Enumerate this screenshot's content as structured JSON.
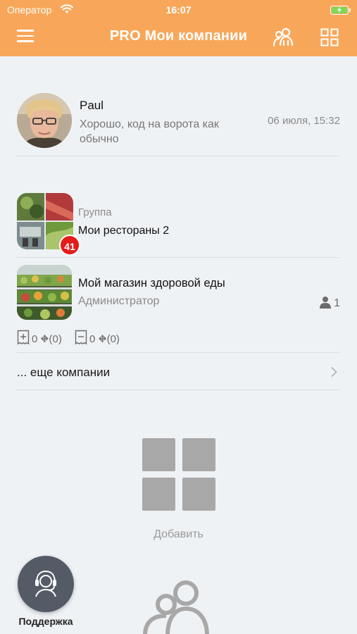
{
  "status_bar": {
    "carrier": "Оператор",
    "time": "16:07",
    "battery_color": "#7ed957"
  },
  "header": {
    "title": "PRO Мои компании",
    "background": "#f8a75a",
    "icons": [
      "menu-icon",
      "people-icon",
      "grid-icon"
    ]
  },
  "chat": {
    "name": "Paul",
    "message": "Хорошо, код на ворота как обычно",
    "time": "06 июля, 15:32"
  },
  "group": {
    "type": "Группа",
    "name": "Мои рестораны 2",
    "badge": "41",
    "badge_color": "#e41b1b"
  },
  "shop": {
    "name": "Мой магазин здоровой еды",
    "role": "Администратор",
    "user_count": "1"
  },
  "stats": {
    "plus_label": "0 ⛕(0)",
    "minus_label": "0 ⛕(0)",
    "plus_count": "0",
    "plus_paren": "(0)",
    "minus_count": "0",
    "minus_paren": "(0)"
  },
  "more": {
    "label": "... еще компании"
  },
  "add": {
    "label": "Добавить"
  },
  "support": {
    "label": "Поддержка"
  }
}
